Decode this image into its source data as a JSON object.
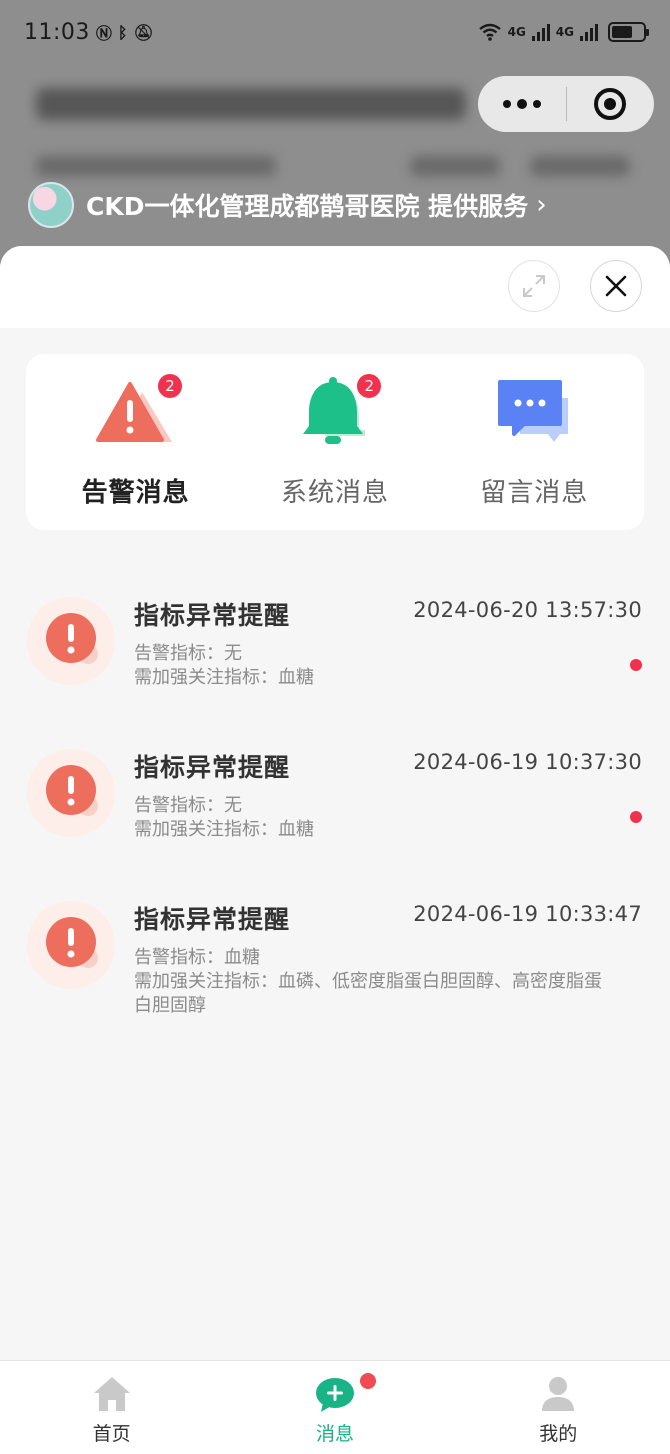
{
  "status_bar": {
    "time": "11:03",
    "network_left": "4G",
    "network_right": "4G"
  },
  "provider": {
    "text": "CKD一体化管理成都鹊哥医院 提供服务",
    "chevron": "›"
  },
  "categories": [
    {
      "label": "告警消息",
      "badge": "2",
      "icon": "warning-icon",
      "color": "#ee6e5e",
      "active": true
    },
    {
      "label": "系统消息",
      "badge": "2",
      "icon": "bell-icon",
      "color": "#1ec08a",
      "active": false
    },
    {
      "label": "留言消息",
      "badge": "",
      "icon": "chat-icon",
      "color": "#5a82f5",
      "active": false
    }
  ],
  "messages": [
    {
      "title": "指标异常提醒",
      "time": "2024-06-20 13:57:30",
      "line1": "告警指标：无",
      "line2": "需加强关注指标：血糖",
      "unread": true
    },
    {
      "title": "指标异常提醒",
      "time": "2024-06-19 10:37:30",
      "line1": "告警指标：无",
      "line2": "需加强关注指标：血糖",
      "unread": true
    },
    {
      "title": "指标异常提醒",
      "time": "2024-06-19 10:33:47",
      "line1": "告警指标：血糖",
      "line2": "需加强关注指标：血磷、低密度脂蛋白胆固醇、高密度脂蛋白胆固醇",
      "unread": false
    }
  ],
  "tabbar": [
    {
      "label": "首页",
      "icon": "home-icon",
      "active": false
    },
    {
      "label": "消息",
      "icon": "message-icon",
      "active": true
    },
    {
      "label": "我的",
      "icon": "profile-icon",
      "active": false
    }
  ],
  "colors": {
    "accent": "#18b386",
    "alert": "#f1314d",
    "warning": "#ee6e5e"
  }
}
